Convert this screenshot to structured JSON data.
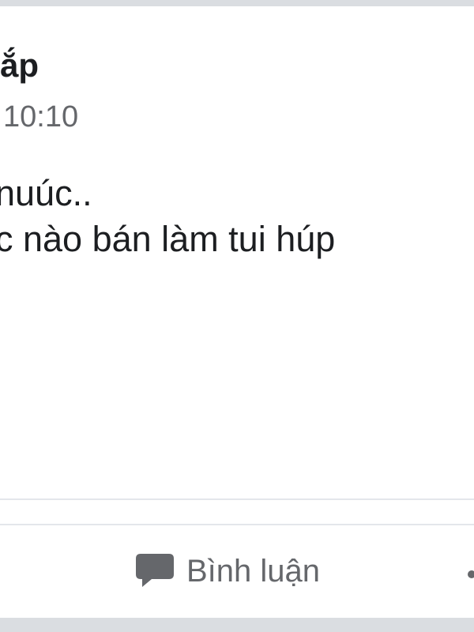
{
  "post": {
    "author_name": "ắp",
    "time": "10:10",
    "body_lines": [
      "nuúc..",
      "c nào bán làm tui húp"
    ]
  },
  "actions": {
    "comment_label": "Bình luận",
    "comment_icon": "speech-bubble-icon",
    "more_icon": "dot-icon"
  },
  "colors": {
    "background": "#dadde1",
    "card": "#ffffff",
    "text_primary": "#1c1e21",
    "text_secondary": "#65676b",
    "divider": "#e4e6eb"
  }
}
